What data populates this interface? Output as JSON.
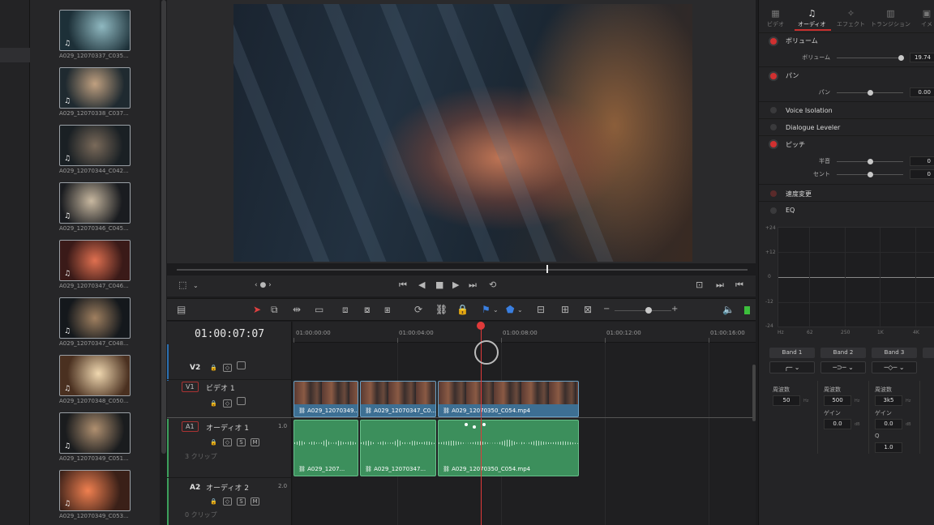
{
  "media_pool": {
    "clips": [
      {
        "label": "A029_12070337_C035...",
        "audio_icon": "♫"
      },
      {
        "label": "A029_12070338_C037...",
        "audio_icon": "♫"
      },
      {
        "label": "A029_12070344_C042...",
        "audio_icon": "♫"
      },
      {
        "label": "A029_12070346_C045...",
        "audio_icon": "♫"
      },
      {
        "label": "A029_12070347_C046...",
        "audio_icon": "♫"
      },
      {
        "label": "A029_12070347_C048...",
        "audio_icon": "♫"
      },
      {
        "label": "A029_12070348_C050...",
        "audio_icon": "♫"
      },
      {
        "label": "A029_12070349_C051...",
        "audio_icon": "♫"
      },
      {
        "label": "A029_12070349_C053...",
        "audio_icon": "♫"
      }
    ]
  },
  "timeline": {
    "timecode": "01:00:07:07",
    "ruler": [
      "01:00:00:00",
      "01:00:04:00",
      "01:00:08:00",
      "01:00:12:00",
      "01:00:16:00"
    ],
    "tracks": {
      "v2": {
        "id": "V2"
      },
      "v1": {
        "id": "V1",
        "name": "ビデオ 1"
      },
      "a1": {
        "id": "A1",
        "name": "オーディオ 1",
        "level": "1.0",
        "clip_count": "3 クリップ"
      },
      "a2": {
        "id": "A2",
        "name": "オーディオ 2",
        "level": "2.0",
        "clip_count": "0 クリップ"
      }
    },
    "video_clips": [
      "A029_12070349...",
      "A029_12070347_C0...",
      "A029_12070350_C054.mp4"
    ],
    "audio_clips": [
      "A029_1207...",
      "A029_12070347...",
      "A029_12070350_C054.mp4"
    ],
    "solo": "S",
    "mute": "M"
  },
  "inspector": {
    "tabs": [
      {
        "label": "ビデオ",
        "icon": "film-icon"
      },
      {
        "label": "オーディオ",
        "icon": "music-note-icon"
      },
      {
        "label": "エフェクト",
        "icon": "magic-wand-icon"
      },
      {
        "label": "トランジション",
        "icon": "transition-icon"
      },
      {
        "label": "イメ",
        "icon": "image-icon"
      }
    ],
    "volume": {
      "title": "ボリューム",
      "label": "ボリューム",
      "value": "19.74"
    },
    "pan": {
      "title": "パン",
      "label": "パン",
      "value": "0.00"
    },
    "voice_isolation": "Voice Isolation",
    "dialogue_leveler": "Dialogue Leveler",
    "pitch": {
      "title": "ピッチ",
      "semitone_label": "半音",
      "semitone_value": "0",
      "cent_label": "セント",
      "cent_value": "0"
    },
    "speed": "速度変更",
    "eq": {
      "title": "EQ",
      "y_labels": [
        "+24",
        "+12",
        "0",
        "-12",
        "-24"
      ],
      "x_labels": [
        "Hz",
        "62",
        "250",
        "1K",
        "4K"
      ],
      "bands": [
        {
          "name": "Band 1",
          "freq_label": "周波数",
          "freq": "50",
          "unit": "Hz"
        },
        {
          "name": "Band 2",
          "freq_label": "周波数",
          "freq": "500",
          "unit": "Hz",
          "gain_label": "ゲイン",
          "gain": "0.0",
          "gain_unit": "dB"
        },
        {
          "name": "Band 3",
          "freq_label": "周波数",
          "freq": "3k5",
          "unit": "Hz",
          "gain_label": "ゲイン",
          "gain": "0.0",
          "gain_unit": "dB",
          "q_label": "Q",
          "q": "1.0"
        }
      ]
    }
  }
}
